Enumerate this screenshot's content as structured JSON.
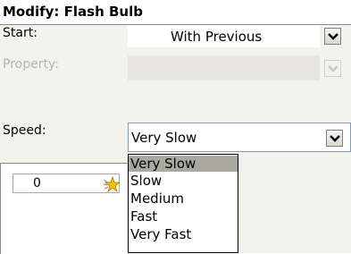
{
  "header": {
    "title": "Modify: Flash Bulb"
  },
  "fields": {
    "start": {
      "label": "Start:",
      "value": "With Previous"
    },
    "property": {
      "label": "Property:",
      "value": ""
    },
    "speed": {
      "label": "Speed:",
      "value": "Very Slow"
    }
  },
  "animation_list": {
    "item_number": "0",
    "item_icon": "star-effect-icon"
  },
  "speed_dropdown": {
    "options": [
      "Very Slow",
      "Slow",
      "Medium",
      "Fast",
      "Very Fast"
    ],
    "selected": "Very Slow"
  },
  "colors": {
    "selection": "#a9a9a0",
    "border": "#7f9db9",
    "panel": "#f3f3ee"
  }
}
